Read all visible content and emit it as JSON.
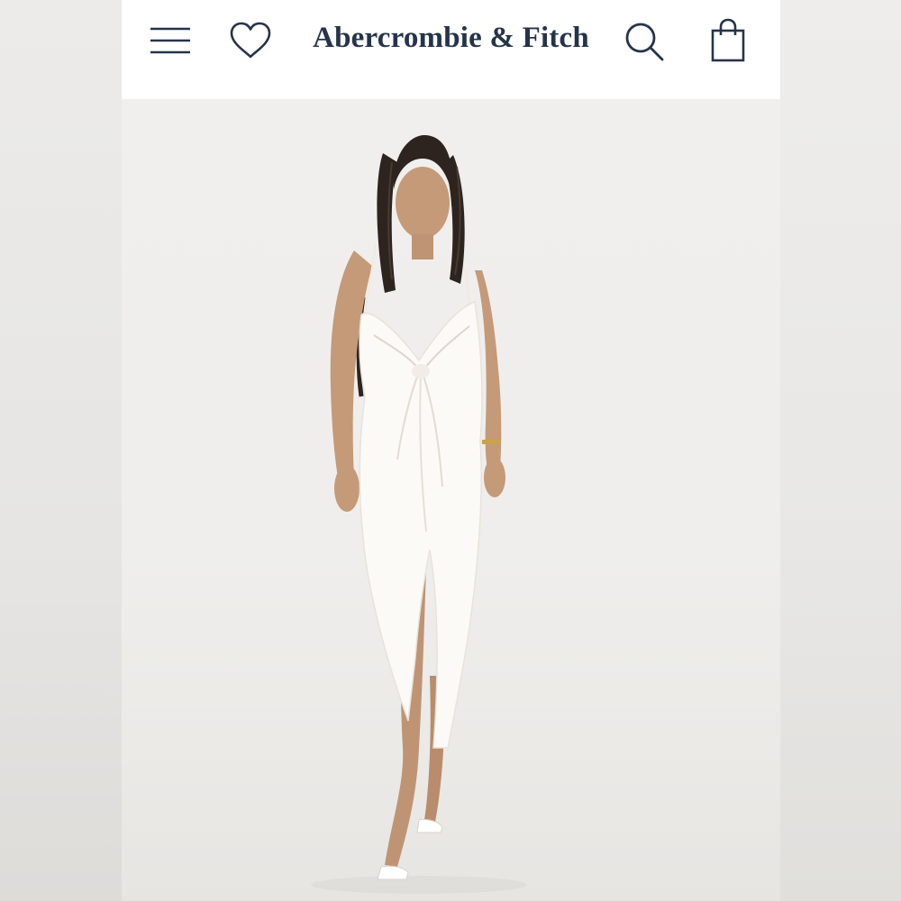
{
  "header": {
    "brand": "Abercrombie & Fitch",
    "icons": {
      "menu": "menu-icon",
      "wishlist": "heart-icon",
      "search": "search-icon",
      "bag": "shopping-bag-icon"
    },
    "icon_color": "#26344a",
    "brand_color": "#26344a"
  },
  "hero": {
    "image": "product-model-photo",
    "subject": "model in white satin midi slip dress with twist front and front slit",
    "background_color": "#f0efed",
    "dress_color": "#fbfaf7"
  }
}
